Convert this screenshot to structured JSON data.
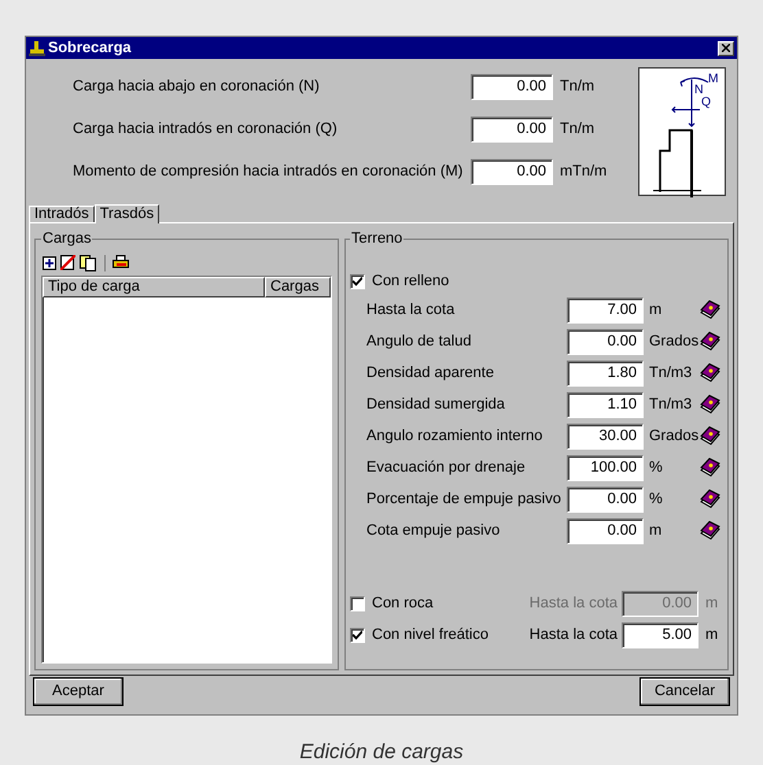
{
  "window": {
    "title": "Sobrecarga"
  },
  "loads": [
    {
      "label": "Carga hacia abajo en coronación (N)",
      "value": "0.00",
      "unit": "Tn/m"
    },
    {
      "label": "Carga hacia intradós en coronación (Q)",
      "value": "0.00",
      "unit": "Tn/m"
    },
    {
      "label": "Momento de compresión hacia intradós en coronación (M)",
      "value": "0.00",
      "unit": "mTn/m"
    }
  ],
  "diagram": {
    "labels": [
      "M",
      "N",
      "Q"
    ]
  },
  "tabs": [
    {
      "label": "Intradós",
      "selected": false
    },
    {
      "label": "Trasdós",
      "selected": true
    }
  ],
  "cargas": {
    "title": "Cargas",
    "columns": [
      "Tipo de carga",
      "Cargas"
    ]
  },
  "terreno": {
    "title": "Terreno",
    "relleno": {
      "label": "Con relleno",
      "checked": true
    },
    "fields": [
      {
        "label": "Hasta la cota",
        "value": "7.00",
        "unit": "m"
      },
      {
        "label": "Angulo de talud",
        "value": "0.00",
        "unit": "Grados"
      },
      {
        "label": "Densidad aparente",
        "value": "1.80",
        "unit": "Tn/m3"
      },
      {
        "label": "Densidad sumergida",
        "value": "1.10",
        "unit": "Tn/m3"
      },
      {
        "label": "Angulo rozamiento interno",
        "value": "30.00",
        "unit": "Grados"
      },
      {
        "label": "Evacuación por drenaje",
        "value": "100.00",
        "unit": "%"
      },
      {
        "label": "Porcentaje de empuje pasivo",
        "value": "0.00",
        "unit": "%"
      },
      {
        "label": "Cota empuje pasivo",
        "value": "0.00",
        "unit": "m"
      }
    ],
    "options": [
      {
        "label": "Con roca",
        "checked": false,
        "field_label": "Hasta la cota",
        "value": "0.00",
        "unit": "m",
        "disabled": true
      },
      {
        "label": "Con nivel freático",
        "checked": true,
        "field_label": "Hasta la cota",
        "value": "5.00",
        "unit": "m",
        "disabled": false
      }
    ]
  },
  "buttons": [
    "Aceptar",
    "Cancelar"
  ],
  "caption": "Edición de cargas"
}
